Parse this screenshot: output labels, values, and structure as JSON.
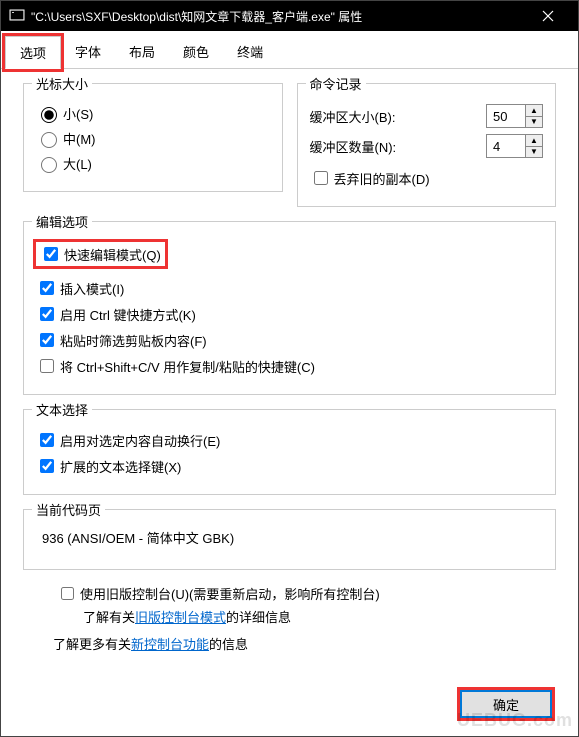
{
  "title": "\"C:\\Users\\SXF\\Desktop\\dist\\知网文章下载器_客户端.exe\" 属性",
  "tabs": [
    "选项",
    "字体",
    "布局",
    "颜色",
    "终端"
  ],
  "active_tab": 0,
  "cursor_size": {
    "title": "光标大小",
    "options": [
      "小(S)",
      "中(M)",
      "大(L)"
    ],
    "selected": 0
  },
  "command_history": {
    "title": "命令记录",
    "buffer_size_label": "缓冲区大小(B):",
    "buffer_size_value": "50",
    "buffer_count_label": "缓冲区数量(N):",
    "buffer_count_value": "4",
    "discard_old_label": "丢弃旧的副本(D)",
    "discard_old_checked": false
  },
  "edit_options": {
    "title": "编辑选项",
    "items": [
      {
        "label": "快速编辑模式(Q)",
        "checked": true
      },
      {
        "label": "插入模式(I)",
        "checked": true
      },
      {
        "label": "启用 Ctrl 键快捷方式(K)",
        "checked": true
      },
      {
        "label": "粘贴时筛选剪贴板内容(F)",
        "checked": true
      },
      {
        "label": "将 Ctrl+Shift+C/V 用作复制/粘贴的快捷键(C)",
        "checked": false
      }
    ]
  },
  "text_select": {
    "title": "文本选择",
    "items": [
      {
        "label": "启用对选定内容自动换行(E)",
        "checked": true
      },
      {
        "label": "扩展的文本选择键(X)",
        "checked": true
      }
    ]
  },
  "codepage": {
    "title": "当前代码页",
    "value": "936   (ANSI/OEM - 简体中文 GBK)"
  },
  "legacy": {
    "label": "使用旧版控制台(U)(需要重新启动，影响所有控制台)",
    "checked": false,
    "info1_prefix": "了解有关",
    "info1_link": "旧版控制台模式",
    "info1_suffix": "的详细信息",
    "info2_prefix": "了解更多有关",
    "info2_link": "新控制台功能",
    "info2_suffix": "的信息"
  },
  "buttons": {
    "ok": "确定"
  },
  "watermark": "UEBUG.com"
}
